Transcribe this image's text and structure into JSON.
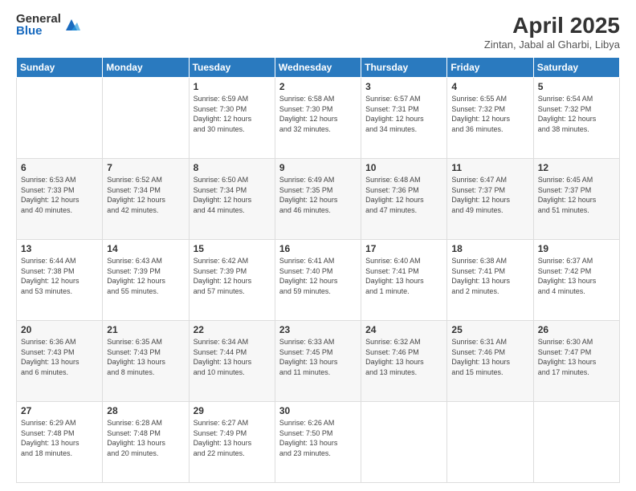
{
  "logo": {
    "general": "General",
    "blue": "Blue"
  },
  "title": "April 2025",
  "subtitle": "Zintan, Jabal al Gharbi, Libya",
  "weekdays": [
    "Sunday",
    "Monday",
    "Tuesday",
    "Wednesday",
    "Thursday",
    "Friday",
    "Saturday"
  ],
  "weeks": [
    [
      {
        "day": "",
        "detail": ""
      },
      {
        "day": "",
        "detail": ""
      },
      {
        "day": "1",
        "detail": "Sunrise: 6:59 AM\nSunset: 7:30 PM\nDaylight: 12 hours\nand 30 minutes."
      },
      {
        "day": "2",
        "detail": "Sunrise: 6:58 AM\nSunset: 7:30 PM\nDaylight: 12 hours\nand 32 minutes."
      },
      {
        "day": "3",
        "detail": "Sunrise: 6:57 AM\nSunset: 7:31 PM\nDaylight: 12 hours\nand 34 minutes."
      },
      {
        "day": "4",
        "detail": "Sunrise: 6:55 AM\nSunset: 7:32 PM\nDaylight: 12 hours\nand 36 minutes."
      },
      {
        "day": "5",
        "detail": "Sunrise: 6:54 AM\nSunset: 7:32 PM\nDaylight: 12 hours\nand 38 minutes."
      }
    ],
    [
      {
        "day": "6",
        "detail": "Sunrise: 6:53 AM\nSunset: 7:33 PM\nDaylight: 12 hours\nand 40 minutes."
      },
      {
        "day": "7",
        "detail": "Sunrise: 6:52 AM\nSunset: 7:34 PM\nDaylight: 12 hours\nand 42 minutes."
      },
      {
        "day": "8",
        "detail": "Sunrise: 6:50 AM\nSunset: 7:34 PM\nDaylight: 12 hours\nand 44 minutes."
      },
      {
        "day": "9",
        "detail": "Sunrise: 6:49 AM\nSunset: 7:35 PM\nDaylight: 12 hours\nand 46 minutes."
      },
      {
        "day": "10",
        "detail": "Sunrise: 6:48 AM\nSunset: 7:36 PM\nDaylight: 12 hours\nand 47 minutes."
      },
      {
        "day": "11",
        "detail": "Sunrise: 6:47 AM\nSunset: 7:37 PM\nDaylight: 12 hours\nand 49 minutes."
      },
      {
        "day": "12",
        "detail": "Sunrise: 6:45 AM\nSunset: 7:37 PM\nDaylight: 12 hours\nand 51 minutes."
      }
    ],
    [
      {
        "day": "13",
        "detail": "Sunrise: 6:44 AM\nSunset: 7:38 PM\nDaylight: 12 hours\nand 53 minutes."
      },
      {
        "day": "14",
        "detail": "Sunrise: 6:43 AM\nSunset: 7:39 PM\nDaylight: 12 hours\nand 55 minutes."
      },
      {
        "day": "15",
        "detail": "Sunrise: 6:42 AM\nSunset: 7:39 PM\nDaylight: 12 hours\nand 57 minutes."
      },
      {
        "day": "16",
        "detail": "Sunrise: 6:41 AM\nSunset: 7:40 PM\nDaylight: 12 hours\nand 59 minutes."
      },
      {
        "day": "17",
        "detail": "Sunrise: 6:40 AM\nSunset: 7:41 PM\nDaylight: 13 hours\nand 1 minute."
      },
      {
        "day": "18",
        "detail": "Sunrise: 6:38 AM\nSunset: 7:41 PM\nDaylight: 13 hours\nand 2 minutes."
      },
      {
        "day": "19",
        "detail": "Sunrise: 6:37 AM\nSunset: 7:42 PM\nDaylight: 13 hours\nand 4 minutes."
      }
    ],
    [
      {
        "day": "20",
        "detail": "Sunrise: 6:36 AM\nSunset: 7:43 PM\nDaylight: 13 hours\nand 6 minutes."
      },
      {
        "day": "21",
        "detail": "Sunrise: 6:35 AM\nSunset: 7:43 PM\nDaylight: 13 hours\nand 8 minutes."
      },
      {
        "day": "22",
        "detail": "Sunrise: 6:34 AM\nSunset: 7:44 PM\nDaylight: 13 hours\nand 10 minutes."
      },
      {
        "day": "23",
        "detail": "Sunrise: 6:33 AM\nSunset: 7:45 PM\nDaylight: 13 hours\nand 11 minutes."
      },
      {
        "day": "24",
        "detail": "Sunrise: 6:32 AM\nSunset: 7:46 PM\nDaylight: 13 hours\nand 13 minutes."
      },
      {
        "day": "25",
        "detail": "Sunrise: 6:31 AM\nSunset: 7:46 PM\nDaylight: 13 hours\nand 15 minutes."
      },
      {
        "day": "26",
        "detail": "Sunrise: 6:30 AM\nSunset: 7:47 PM\nDaylight: 13 hours\nand 17 minutes."
      }
    ],
    [
      {
        "day": "27",
        "detail": "Sunrise: 6:29 AM\nSunset: 7:48 PM\nDaylight: 13 hours\nand 18 minutes."
      },
      {
        "day": "28",
        "detail": "Sunrise: 6:28 AM\nSunset: 7:48 PM\nDaylight: 13 hours\nand 20 minutes."
      },
      {
        "day": "29",
        "detail": "Sunrise: 6:27 AM\nSunset: 7:49 PM\nDaylight: 13 hours\nand 22 minutes."
      },
      {
        "day": "30",
        "detail": "Sunrise: 6:26 AM\nSunset: 7:50 PM\nDaylight: 13 hours\nand 23 minutes."
      },
      {
        "day": "",
        "detail": ""
      },
      {
        "day": "",
        "detail": ""
      },
      {
        "day": "",
        "detail": ""
      }
    ]
  ]
}
